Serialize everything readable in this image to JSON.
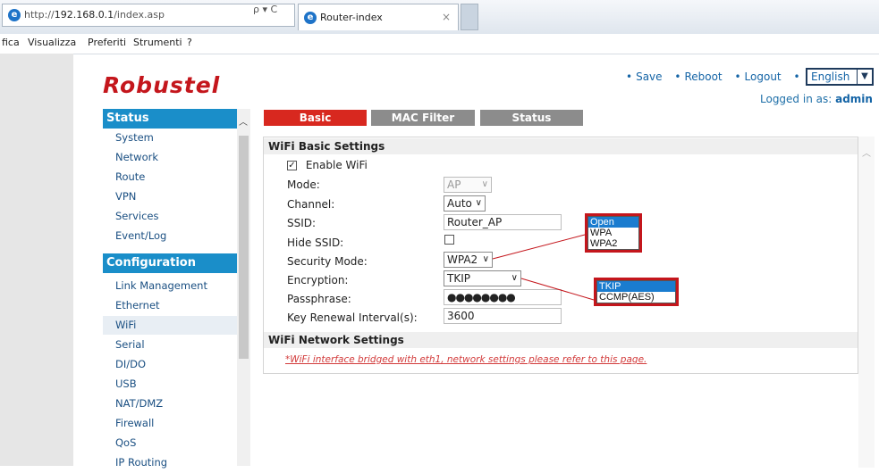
{
  "browser": {
    "url_prefix": "http://",
    "url_host": "192.168.0.1",
    "url_path": "/index.asp",
    "url_tools": "ρ ▾ C",
    "tab_title": "Router-index",
    "tab_close": "×"
  },
  "menu": [
    "fica",
    "Visualizza",
    "Preferiti",
    "Strumenti",
    "?"
  ],
  "brand": "Robustel",
  "top_links": [
    "Save",
    "Reboot",
    "Logout"
  ],
  "language": "English",
  "logged_in": {
    "label": "Logged in as:",
    "user": "admin"
  },
  "sidebar": {
    "status_title": "Status",
    "status_items": [
      "System",
      "Network",
      "Route",
      "VPN",
      "Services",
      "Event/Log"
    ],
    "config_title": "Configuration",
    "config_items": [
      "Link Management",
      "Ethernet",
      "WiFi",
      "Serial",
      "DI/DO",
      "USB",
      "NAT/DMZ",
      "Firewall",
      "QoS",
      "IP Routing"
    ],
    "active": "WiFi"
  },
  "tabs": [
    "Basic",
    "MAC Filter",
    "Status"
  ],
  "wifi_basic": {
    "title": "WiFi Basic Settings",
    "enable_label": "Enable WiFi",
    "enable_checked": true,
    "fields": {
      "mode": {
        "label": "Mode:",
        "value": "AP"
      },
      "channel": {
        "label": "Channel:",
        "value": "Auto"
      },
      "ssid": {
        "label": "SSID:",
        "value": "Router_AP"
      },
      "hide_ssid": {
        "label": "Hide SSID:",
        "checked": false
      },
      "security_mode": {
        "label": "Security Mode:",
        "value": "WPA2"
      },
      "encryption": {
        "label": "Encryption:",
        "value": "TKIP"
      },
      "passphrase": {
        "label": "Passphrase:",
        "value": "●●●●●●●●"
      },
      "key_renewal": {
        "label": "Key Renewal Interval(s):",
        "value": "3600"
      }
    }
  },
  "security_options": [
    "Open",
    "WPA",
    "WPA2"
  ],
  "security_highlight": "Open",
  "encryption_options": [
    "TKIP",
    "CCMP(AES)"
  ],
  "encryption_highlight": "TKIP",
  "wifi_network": {
    "title": "WiFi Network Settings",
    "note": "*WiFi interface bridged with eth1, network settings please refer to this page."
  },
  "colors": {
    "brand_red": "#c4161c",
    "sidebar_blue": "#1a8ec9",
    "tab_grey": "#8c8c8c",
    "link_blue": "#1464a6"
  }
}
